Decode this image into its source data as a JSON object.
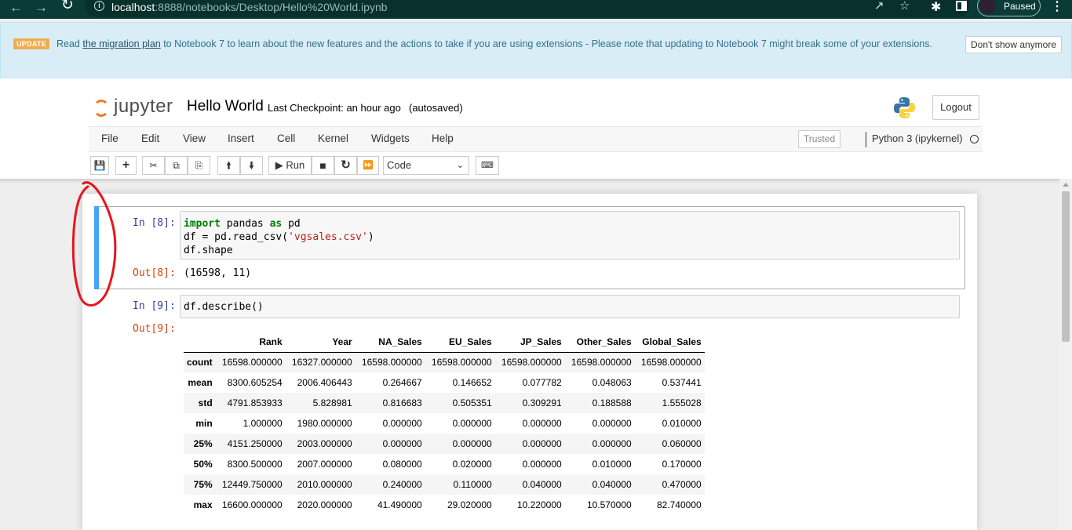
{
  "browser": {
    "url_host": "localhost",
    "url_path": ":8888/notebooks/Desktop/Hello%20World.ipynb",
    "profile_status": "Paused"
  },
  "banner": {
    "badge": "UPDATE",
    "text_before": "Read ",
    "link": "the migration plan",
    "text_after": " to Notebook 7 to learn about the new features and the actions to take if you are using extensions - Please note that updating to Notebook 7 might break some of your extensions.",
    "dismiss_label": "Don't show anymore"
  },
  "header": {
    "logo_text": "jupyter",
    "notebook_name": "Hello World",
    "checkpoint": "Last Checkpoint: an hour ago",
    "autosave": "(autosaved)",
    "logout_label": "Logout"
  },
  "menu": {
    "items": [
      "File",
      "Edit",
      "View",
      "Insert",
      "Cell",
      "Kernel",
      "Widgets",
      "Help"
    ],
    "trusted": "Trusted",
    "kernel": "Python 3 (ipykernel)"
  },
  "toolbar": {
    "run_label": "Run",
    "cell_type": "Code"
  },
  "cells": [
    {
      "in_prompt": "In [8]:",
      "code_lines": [
        "import pandas as pd",
        "df = pd.read_csv('vgsales.csv')",
        "df.shape"
      ],
      "out_prompt": "Out[8]:",
      "output": "(16598, 11)"
    },
    {
      "in_prompt": "In [9]:",
      "code_lines": [
        "df.describe()"
      ],
      "out_prompt": "Out[9]:"
    }
  ],
  "describe_table": {
    "columns": [
      "Rank",
      "Year",
      "NA_Sales",
      "EU_Sales",
      "JP_Sales",
      "Other_Sales",
      "Global_Sales"
    ],
    "rows": [
      {
        "label": "count",
        "values": [
          "16598.000000",
          "16327.000000",
          "16598.000000",
          "16598.000000",
          "16598.000000",
          "16598.000000",
          "16598.000000"
        ]
      },
      {
        "label": "mean",
        "values": [
          "8300.605254",
          "2006.406443",
          "0.264667",
          "0.146652",
          "0.077782",
          "0.048063",
          "0.537441"
        ]
      },
      {
        "label": "std",
        "values": [
          "4791.853933",
          "5.828981",
          "0.816683",
          "0.505351",
          "0.309291",
          "0.188588",
          "1.555028"
        ]
      },
      {
        "label": "min",
        "values": [
          "1.000000",
          "1980.000000",
          "0.000000",
          "0.000000",
          "0.000000",
          "0.000000",
          "0.010000"
        ]
      },
      {
        "label": "25%",
        "values": [
          "4151.250000",
          "2003.000000",
          "0.000000",
          "0.000000",
          "0.000000",
          "0.000000",
          "0.060000"
        ]
      },
      {
        "label": "50%",
        "values": [
          "8300.500000",
          "2007.000000",
          "0.080000",
          "0.020000",
          "0.000000",
          "0.010000",
          "0.170000"
        ]
      },
      {
        "label": "75%",
        "values": [
          "12449.750000",
          "2010.000000",
          "0.240000",
          "0.110000",
          "0.040000",
          "0.040000",
          "0.470000"
        ]
      },
      {
        "label": "max",
        "values": [
          "16600.000000",
          "2020.000000",
          "41.490000",
          "29.020000",
          "10.220000",
          "10.570000",
          "82.740000"
        ]
      }
    ]
  },
  "colors": {
    "browser_bar": "#0b3b36",
    "selected_cell_bar": "#42a5f5",
    "in_prompt": "#303f9f",
    "out_prompt": "#d84315",
    "annotation": "#e8141b"
  }
}
